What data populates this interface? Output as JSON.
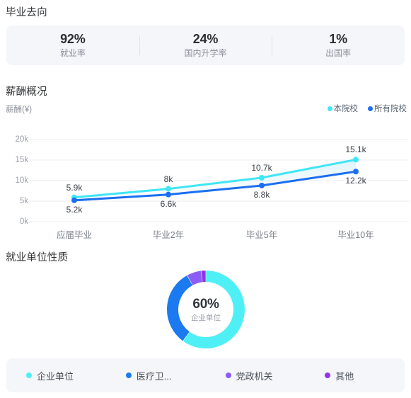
{
  "destination": {
    "title": "毕业去向",
    "stats": [
      {
        "value": "92%",
        "label": "就业率"
      },
      {
        "value": "24%",
        "label": "国内升学率"
      },
      {
        "value": "1%",
        "label": "出国率"
      }
    ]
  },
  "salary": {
    "title": "薪酬概况",
    "axis_unit_label": "薪酬(¥)",
    "legend": [
      {
        "label": "本院校",
        "color": "#3fe6f5"
      },
      {
        "label": "所有院校",
        "color": "#1b6ff0"
      }
    ]
  },
  "employer": {
    "title": "就业单位性质",
    "center_value": "60%",
    "center_label": "企业单位",
    "legend": [
      {
        "label": "企业单位",
        "color": "#4ef0f5"
      },
      {
        "label": "医疗卫...",
        "color": "#1b7af0"
      },
      {
        "label": "党政机关",
        "color": "#8b5cf6"
      },
      {
        "label": "其他",
        "color": "#9333ea"
      }
    ]
  },
  "chart_data": [
    {
      "type": "line",
      "title": "薪酬概况",
      "xlabel": "",
      "ylabel": "薪酬(¥)",
      "categories": [
        "应届毕业",
        "毕业2年",
        "毕业5年",
        "毕业10年"
      ],
      "yticks": [
        "0k",
        "5k",
        "10k",
        "15k",
        "20k"
      ],
      "ylim": [
        0,
        20000
      ],
      "grid": true,
      "legend_position": "top-right",
      "series": [
        {
          "name": "本院校",
          "color": "#3fe6f5",
          "values": [
            5900,
            8000,
            10700,
            15100
          ],
          "labels": [
            "5.9k",
            "8k",
            "10.7k",
            "15.1k"
          ],
          "label_side": "above"
        },
        {
          "name": "所有院校",
          "color": "#1b6ff0",
          "values": [
            5200,
            6600,
            8800,
            12200
          ],
          "labels": [
            "5.2k",
            "6.6k",
            "8.8k",
            "12.2k"
          ],
          "label_side": "below"
        }
      ]
    },
    {
      "type": "pie",
      "title": "就业单位性质",
      "donut": true,
      "center_value": "60%",
      "center_label": "企业单位",
      "legend_position": "bottom",
      "categories": [
        "企业单位",
        "医疗卫...",
        "党政机关",
        "其他"
      ],
      "values": [
        60,
        32,
        6,
        2
      ],
      "colors": [
        "#4ef0f5",
        "#1b7af0",
        "#8b5cf6",
        "#9333ea"
      ]
    }
  ]
}
